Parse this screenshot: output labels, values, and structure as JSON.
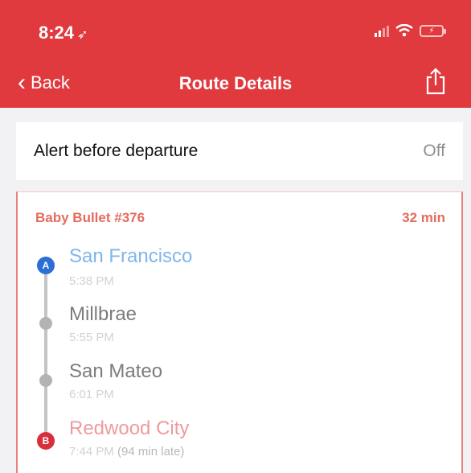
{
  "status_bar": {
    "time": "8:24",
    "location_icon": "location-arrow-icon",
    "icons": [
      "signal-icon",
      "wifi-icon",
      "battery-charging-icon"
    ]
  },
  "nav": {
    "back_label": "Back",
    "title": "Route Details",
    "share_icon": "share-icon"
  },
  "alert": {
    "label": "Alert before departure",
    "value": "Off"
  },
  "route": {
    "train": "Baby Bullet #376",
    "duration": "32 min",
    "stops": [
      {
        "badge": "A",
        "name": "San Francisco",
        "time": "5:38 PM"
      },
      {
        "name": "Millbrae",
        "time": "5:55 PM"
      },
      {
        "name": "San Mateo",
        "time": "6:01 PM"
      },
      {
        "badge": "B",
        "name": "Redwood City",
        "time": "7:44 PM",
        "delay": "(94 min late)"
      }
    ]
  },
  "colors": {
    "brand": "#e03a3e",
    "origin": "#2b6ed6",
    "destination": "#d92f3b"
  }
}
